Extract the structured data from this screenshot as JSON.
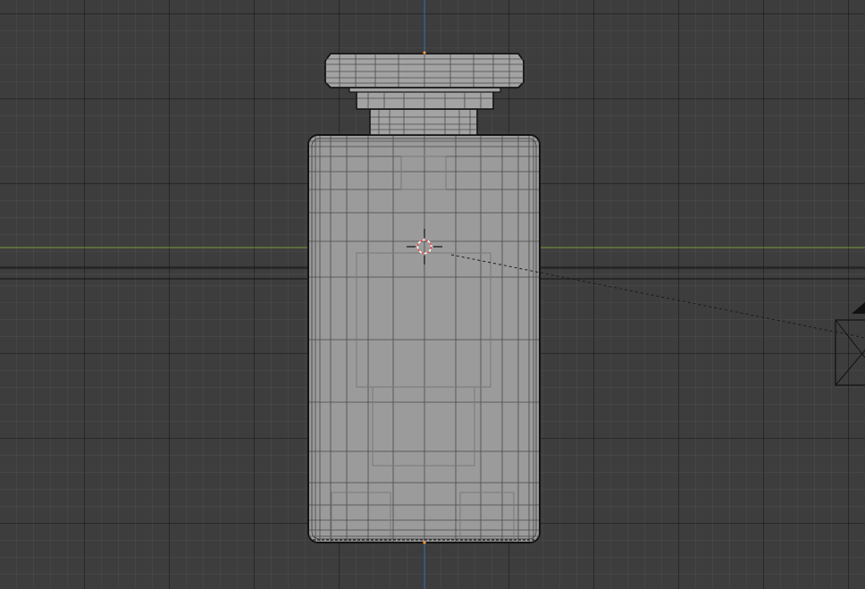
{
  "viewport": {
    "view": "front-orthographic",
    "mode": "edit-wireframe",
    "background_color": "#3d3d3d",
    "grid_color": "#2f2f2f",
    "x_axis_color": "#7a9a3a",
    "z_axis_color": "#3d6ea8",
    "mesh_fill_color": "#9b9b9b",
    "mesh_edge_color": "#1e1e1e",
    "cursor_color": "#e05050"
  },
  "scene_objects": [
    {
      "name": "bottle-body",
      "icon": "mesh-icon"
    },
    {
      "name": "bottle-cap",
      "icon": "mesh-icon"
    },
    {
      "name": "camera",
      "icon": "camera-icon"
    },
    {
      "name": "3d-cursor",
      "icon": "crosshair-icon"
    }
  ]
}
